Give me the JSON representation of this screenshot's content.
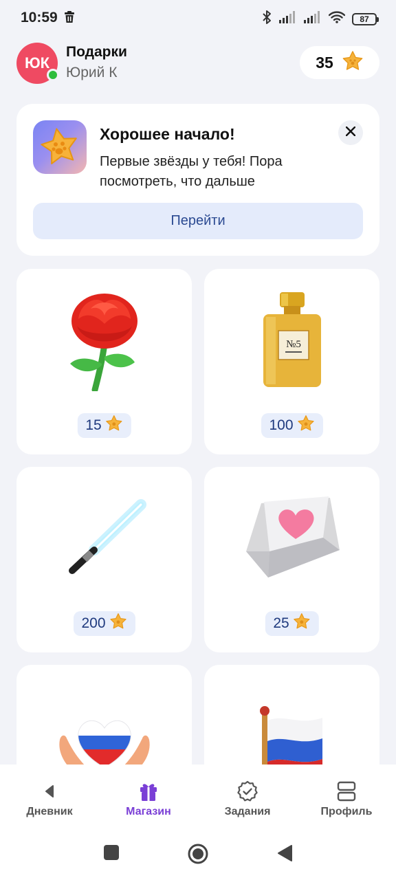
{
  "status_bar": {
    "time": "10:59",
    "battery": "87",
    "icons": [
      "trash-icon",
      "bluetooth-icon",
      "signal-icon",
      "signal-icon",
      "wifi-icon",
      "battery-icon"
    ]
  },
  "header": {
    "avatar_initials": "ЮК",
    "title": "Подарки",
    "user_name": "Юрий К",
    "balance": "35",
    "balance_icon": "star-icon"
  },
  "promo": {
    "title": "Хорошее начало!",
    "text": "Первые звёзды у тебя! Пора посмотреть, что дальше",
    "button_label": "Перейти",
    "image_icon": "star-paw-icon",
    "close_icon": "close-icon"
  },
  "gifts": [
    {
      "name": "rose",
      "price": "15"
    },
    {
      "name": "perfume",
      "price": "100"
    },
    {
      "name": "lightsaber",
      "price": "200"
    },
    {
      "name": "heart-key",
      "price": "25"
    },
    {
      "name": "hands-heart-flag",
      "price": ""
    },
    {
      "name": "russian-flag",
      "price": ""
    }
  ],
  "perfume_label": "№5",
  "bottom_nav": [
    {
      "label": "Дневник",
      "icon": "back-arrow-icon",
      "active": false
    },
    {
      "label": "Магазин",
      "icon": "gift-icon",
      "active": true
    },
    {
      "label": "Задания",
      "icon": "badge-check-icon",
      "active": false
    },
    {
      "label": "Профиль",
      "icon": "profile-icon",
      "active": false
    }
  ],
  "colors": {
    "accent": "#7a3fd6",
    "avatar_bg": "#ef4a62",
    "online": "#2ebd3c",
    "price_text": "#1f3a7e",
    "price_bg": "#e8eefb",
    "button_bg": "#e4ebfb"
  }
}
